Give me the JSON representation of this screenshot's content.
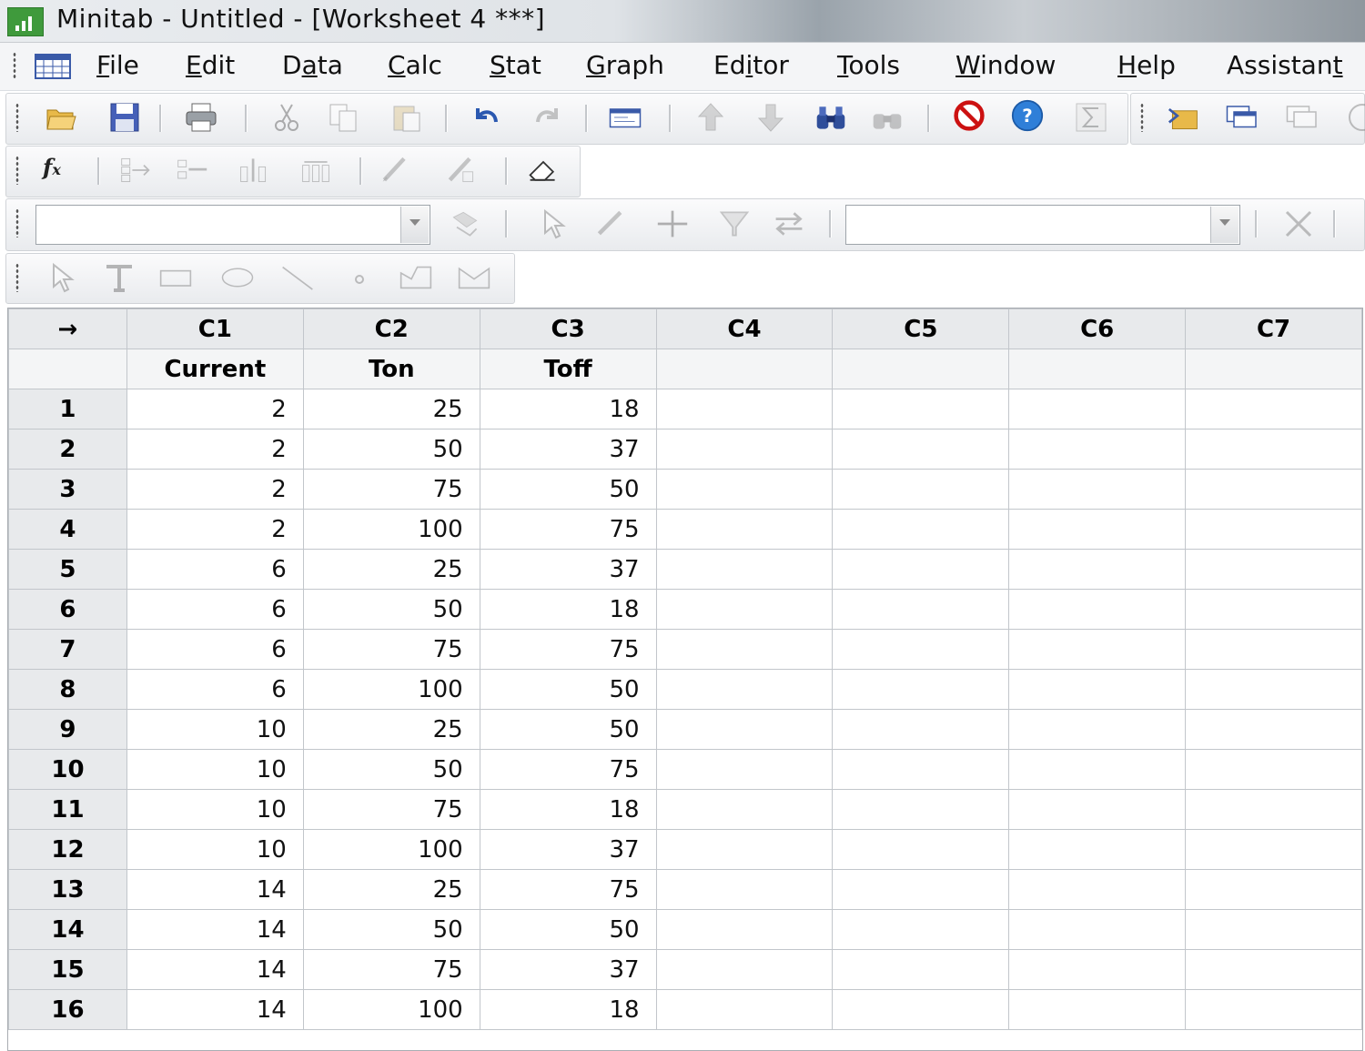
{
  "window": {
    "title": "Minitab - Untitled - [Worksheet 4 ***]"
  },
  "menu": [
    {
      "u": "F",
      "rest": "ile"
    },
    {
      "u": "E",
      "rest": "dit"
    },
    {
      "u": "",
      "pre": "D",
      "u2": "a",
      "rest": "ta"
    },
    {
      "u": "C",
      "rest": "alc"
    },
    {
      "u": "S",
      "rest": "tat"
    },
    {
      "u": "G",
      "rest": "raph"
    },
    {
      "u": "",
      "pre": "Ed",
      "u2": "i",
      "rest": "tor"
    },
    {
      "u": "T",
      "rest": "ools"
    },
    {
      "u": "W",
      "rest": "indow"
    },
    {
      "u": "H",
      "rest": "elp"
    },
    {
      "u": "",
      "pre": "Assistan",
      "u2": "t",
      "rest": ""
    }
  ],
  "worksheet": {
    "corner": "→",
    "columns": [
      "C1",
      "C2",
      "C3",
      "C4",
      "C5",
      "C6",
      "C7"
    ],
    "names": [
      "Current",
      "Ton",
      "Toff",
      "",
      "",
      "",
      ""
    ],
    "rows": [
      [
        "1",
        "2",
        "25",
        "18"
      ],
      [
        "2",
        "2",
        "50",
        "37"
      ],
      [
        "3",
        "2",
        "75",
        "50"
      ],
      [
        "4",
        "2",
        "100",
        "75"
      ],
      [
        "5",
        "6",
        "25",
        "37"
      ],
      [
        "6",
        "6",
        "50",
        "18"
      ],
      [
        "7",
        "6",
        "75",
        "75"
      ],
      [
        "8",
        "6",
        "100",
        "50"
      ],
      [
        "9",
        "10",
        "25",
        "50"
      ],
      [
        "10",
        "10",
        "50",
        "75"
      ],
      [
        "11",
        "10",
        "75",
        "18"
      ],
      [
        "12",
        "10",
        "100",
        "37"
      ],
      [
        "13",
        "14",
        "25",
        "75"
      ],
      [
        "14",
        "14",
        "50",
        "50"
      ],
      [
        "15",
        "14",
        "75",
        "37"
      ],
      [
        "16",
        "14",
        "100",
        "18"
      ]
    ]
  },
  "colors": {
    "title_icon": "#3f9a3c",
    "help_icon": "#2f7fd8",
    "stop_icon": "#cc1111"
  }
}
